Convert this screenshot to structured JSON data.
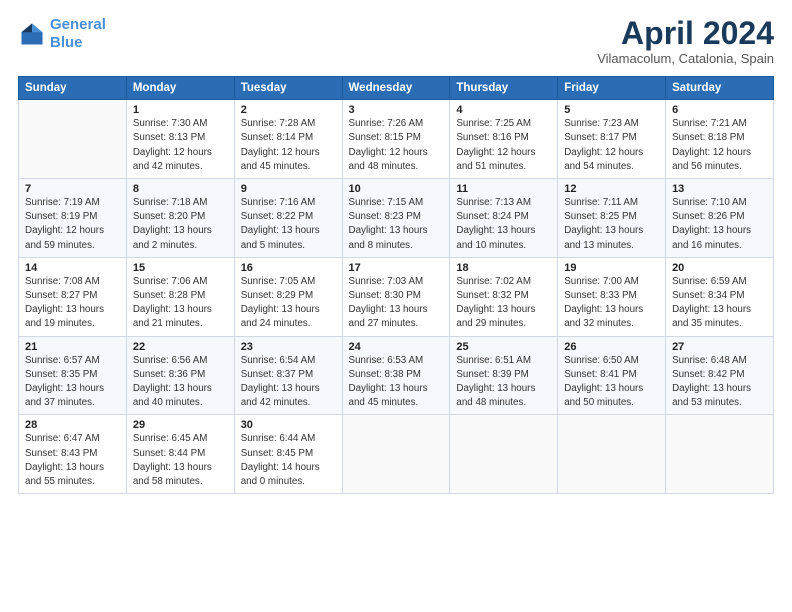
{
  "logo": {
    "line1": "General",
    "line2": "Blue"
  },
  "title": "April 2024",
  "subtitle": "Vilamacolum, Catalonia, Spain",
  "days_of_week": [
    "Sunday",
    "Monday",
    "Tuesday",
    "Wednesday",
    "Thursday",
    "Friday",
    "Saturday"
  ],
  "weeks": [
    [
      {
        "day": "",
        "info": ""
      },
      {
        "day": "1",
        "info": "Sunrise: 7:30 AM\nSunset: 8:13 PM\nDaylight: 12 hours\nand 42 minutes."
      },
      {
        "day": "2",
        "info": "Sunrise: 7:28 AM\nSunset: 8:14 PM\nDaylight: 12 hours\nand 45 minutes."
      },
      {
        "day": "3",
        "info": "Sunrise: 7:26 AM\nSunset: 8:15 PM\nDaylight: 12 hours\nand 48 minutes."
      },
      {
        "day": "4",
        "info": "Sunrise: 7:25 AM\nSunset: 8:16 PM\nDaylight: 12 hours\nand 51 minutes."
      },
      {
        "day": "5",
        "info": "Sunrise: 7:23 AM\nSunset: 8:17 PM\nDaylight: 12 hours\nand 54 minutes."
      },
      {
        "day": "6",
        "info": "Sunrise: 7:21 AM\nSunset: 8:18 PM\nDaylight: 12 hours\nand 56 minutes."
      }
    ],
    [
      {
        "day": "7",
        "info": "Sunrise: 7:19 AM\nSunset: 8:19 PM\nDaylight: 12 hours\nand 59 minutes."
      },
      {
        "day": "8",
        "info": "Sunrise: 7:18 AM\nSunset: 8:20 PM\nDaylight: 13 hours\nand 2 minutes."
      },
      {
        "day": "9",
        "info": "Sunrise: 7:16 AM\nSunset: 8:22 PM\nDaylight: 13 hours\nand 5 minutes."
      },
      {
        "day": "10",
        "info": "Sunrise: 7:15 AM\nSunset: 8:23 PM\nDaylight: 13 hours\nand 8 minutes."
      },
      {
        "day": "11",
        "info": "Sunrise: 7:13 AM\nSunset: 8:24 PM\nDaylight: 13 hours\nand 10 minutes."
      },
      {
        "day": "12",
        "info": "Sunrise: 7:11 AM\nSunset: 8:25 PM\nDaylight: 13 hours\nand 13 minutes."
      },
      {
        "day": "13",
        "info": "Sunrise: 7:10 AM\nSunset: 8:26 PM\nDaylight: 13 hours\nand 16 minutes."
      }
    ],
    [
      {
        "day": "14",
        "info": "Sunrise: 7:08 AM\nSunset: 8:27 PM\nDaylight: 13 hours\nand 19 minutes."
      },
      {
        "day": "15",
        "info": "Sunrise: 7:06 AM\nSunset: 8:28 PM\nDaylight: 13 hours\nand 21 minutes."
      },
      {
        "day": "16",
        "info": "Sunrise: 7:05 AM\nSunset: 8:29 PM\nDaylight: 13 hours\nand 24 minutes."
      },
      {
        "day": "17",
        "info": "Sunrise: 7:03 AM\nSunset: 8:30 PM\nDaylight: 13 hours\nand 27 minutes."
      },
      {
        "day": "18",
        "info": "Sunrise: 7:02 AM\nSunset: 8:32 PM\nDaylight: 13 hours\nand 29 minutes."
      },
      {
        "day": "19",
        "info": "Sunrise: 7:00 AM\nSunset: 8:33 PM\nDaylight: 13 hours\nand 32 minutes."
      },
      {
        "day": "20",
        "info": "Sunrise: 6:59 AM\nSunset: 8:34 PM\nDaylight: 13 hours\nand 35 minutes."
      }
    ],
    [
      {
        "day": "21",
        "info": "Sunrise: 6:57 AM\nSunset: 8:35 PM\nDaylight: 13 hours\nand 37 minutes."
      },
      {
        "day": "22",
        "info": "Sunrise: 6:56 AM\nSunset: 8:36 PM\nDaylight: 13 hours\nand 40 minutes."
      },
      {
        "day": "23",
        "info": "Sunrise: 6:54 AM\nSunset: 8:37 PM\nDaylight: 13 hours\nand 42 minutes."
      },
      {
        "day": "24",
        "info": "Sunrise: 6:53 AM\nSunset: 8:38 PM\nDaylight: 13 hours\nand 45 minutes."
      },
      {
        "day": "25",
        "info": "Sunrise: 6:51 AM\nSunset: 8:39 PM\nDaylight: 13 hours\nand 48 minutes."
      },
      {
        "day": "26",
        "info": "Sunrise: 6:50 AM\nSunset: 8:41 PM\nDaylight: 13 hours\nand 50 minutes."
      },
      {
        "day": "27",
        "info": "Sunrise: 6:48 AM\nSunset: 8:42 PM\nDaylight: 13 hours\nand 53 minutes."
      }
    ],
    [
      {
        "day": "28",
        "info": "Sunrise: 6:47 AM\nSunset: 8:43 PM\nDaylight: 13 hours\nand 55 minutes."
      },
      {
        "day": "29",
        "info": "Sunrise: 6:45 AM\nSunset: 8:44 PM\nDaylight: 13 hours\nand 58 minutes."
      },
      {
        "day": "30",
        "info": "Sunrise: 6:44 AM\nSunset: 8:45 PM\nDaylight: 14 hours\nand 0 minutes."
      },
      {
        "day": "",
        "info": ""
      },
      {
        "day": "",
        "info": ""
      },
      {
        "day": "",
        "info": ""
      },
      {
        "day": "",
        "info": ""
      }
    ]
  ]
}
